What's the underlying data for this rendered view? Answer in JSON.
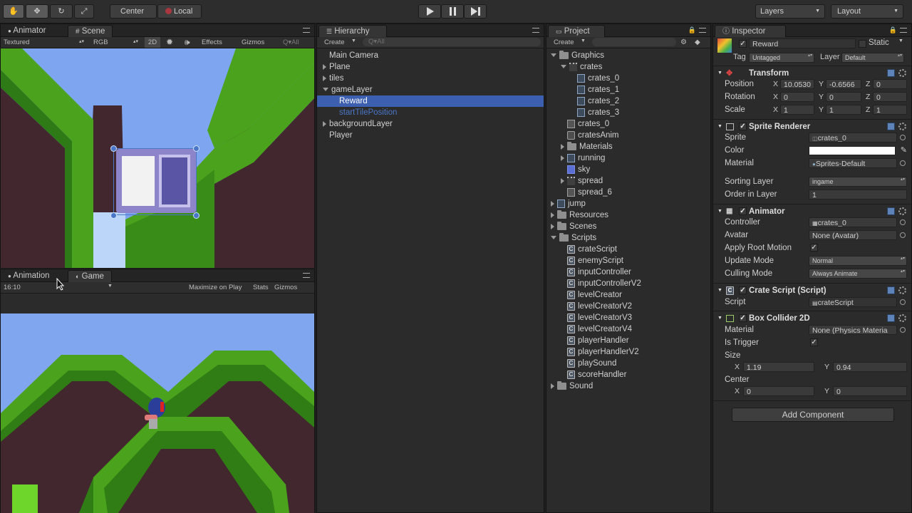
{
  "toolbar": {
    "pivot_label": "Center",
    "space_label": "Local",
    "layers_label": "Layers",
    "layout_label": "Layout"
  },
  "scene_panel": {
    "tabs": [
      "Animator",
      "Scene"
    ],
    "draw_mode": "Textured",
    "render_mode": "RGB",
    "mode_2d": "2D",
    "effects": "Effects",
    "gizmos": "Gizmos",
    "search": "Q▾All"
  },
  "game_panel": {
    "tabs": [
      "Animation",
      "Game"
    ],
    "aspect": "16:10",
    "maximize": "Maximize on Play",
    "stats": "Stats",
    "gizmos": "Gizmos"
  },
  "hierarchy": {
    "title": "Hierarchy",
    "create": "Create",
    "search": "Q▾All",
    "items": [
      {
        "label": "Main Camera",
        "indent": 0,
        "arrow": "none",
        "selected": false,
        "prefab": false
      },
      {
        "label": "Plane",
        "indent": 0,
        "arrow": "right",
        "selected": false,
        "prefab": false
      },
      {
        "label": "tiles",
        "indent": 0,
        "arrow": "right",
        "selected": false,
        "prefab": false
      },
      {
        "label": "gameLayer",
        "indent": 0,
        "arrow": "down",
        "selected": false,
        "prefab": false
      },
      {
        "label": "Reward",
        "indent": 1,
        "arrow": "none",
        "selected": true,
        "prefab": false
      },
      {
        "label": "startTilePosition",
        "indent": 1,
        "arrow": "none",
        "selected": false,
        "prefab": true
      },
      {
        "label": "backgroundLayer",
        "indent": 0,
        "arrow": "right",
        "selected": false,
        "prefab": false
      },
      {
        "label": "Player",
        "indent": 0,
        "arrow": "none",
        "selected": false,
        "prefab": false
      }
    ]
  },
  "project": {
    "title": "Project",
    "create": "Create",
    "items": [
      {
        "label": "Graphics",
        "indent": 0,
        "arrow": "down",
        "icon": "folder"
      },
      {
        "label": "crates",
        "indent": 1,
        "arrow": "down",
        "icon": "sprite-sheet"
      },
      {
        "label": "crates_0",
        "indent": 2,
        "arrow": "none",
        "icon": "sprite"
      },
      {
        "label": "crates_1",
        "indent": 2,
        "arrow": "none",
        "icon": "sprite"
      },
      {
        "label": "crates_2",
        "indent": 2,
        "arrow": "none",
        "icon": "sprite"
      },
      {
        "label": "crates_3",
        "indent": 2,
        "arrow": "none",
        "icon": "sprite"
      },
      {
        "label": "crates_0",
        "indent": 1,
        "arrow": "none",
        "icon": "animator"
      },
      {
        "label": "cratesAnim",
        "indent": 1,
        "arrow": "none",
        "icon": "anim"
      },
      {
        "label": "Materials",
        "indent": 1,
        "arrow": "right",
        "icon": "folder"
      },
      {
        "label": "running",
        "indent": 1,
        "arrow": "right",
        "icon": "sprite"
      },
      {
        "label": "sky",
        "indent": 1,
        "arrow": "none",
        "icon": "blue"
      },
      {
        "label": "spread",
        "indent": 1,
        "arrow": "right",
        "icon": "sprite-sheet"
      },
      {
        "label": "spread_6",
        "indent": 1,
        "arrow": "none",
        "icon": "animator"
      },
      {
        "label": "jump",
        "indent": 0,
        "arrow": "right",
        "icon": "sprite"
      },
      {
        "label": "Resources",
        "indent": 0,
        "arrow": "right",
        "icon": "folder"
      },
      {
        "label": "Scenes",
        "indent": 0,
        "arrow": "right",
        "icon": "folder"
      },
      {
        "label": "Scripts",
        "indent": 0,
        "arrow": "down",
        "icon": "folder"
      },
      {
        "label": "crateScript",
        "indent": 1,
        "arrow": "none",
        "icon": "script"
      },
      {
        "label": "enemyScript",
        "indent": 1,
        "arrow": "none",
        "icon": "script"
      },
      {
        "label": "inputController",
        "indent": 1,
        "arrow": "none",
        "icon": "script"
      },
      {
        "label": "inputControllerV2",
        "indent": 1,
        "arrow": "none",
        "icon": "script"
      },
      {
        "label": "levelCreator",
        "indent": 1,
        "arrow": "none",
        "icon": "script"
      },
      {
        "label": "levelCreatorV2",
        "indent": 1,
        "arrow": "none",
        "icon": "script"
      },
      {
        "label": "levelCreatorV3",
        "indent": 1,
        "arrow": "none",
        "icon": "script"
      },
      {
        "label": "levelCreatorV4",
        "indent": 1,
        "arrow": "none",
        "icon": "script"
      },
      {
        "label": "playerHandler",
        "indent": 1,
        "arrow": "none",
        "icon": "script"
      },
      {
        "label": "playerHandlerV2",
        "indent": 1,
        "arrow": "none",
        "icon": "script"
      },
      {
        "label": "playSound",
        "indent": 1,
        "arrow": "none",
        "icon": "script"
      },
      {
        "label": "scoreHandler",
        "indent": 1,
        "arrow": "none",
        "icon": "script"
      },
      {
        "label": "Sound",
        "indent": 0,
        "arrow": "right",
        "icon": "folder"
      }
    ]
  },
  "inspector": {
    "title": "Inspector",
    "object_name": "Reward",
    "static_label": "Static",
    "tag_label": "Tag",
    "tag_value": "Untagged",
    "layer_label": "Layer",
    "layer_value": "Default",
    "transform": {
      "title": "Transform",
      "position_label": "Position",
      "position": [
        "10.0530",
        "-0.6566",
        "0"
      ],
      "rotation_label": "Rotation",
      "rotation": [
        "0",
        "0",
        "0"
      ],
      "scale_label": "Scale",
      "scale": [
        "1",
        "1",
        "1"
      ]
    },
    "sprite_renderer": {
      "title": "Sprite Renderer",
      "sprite_label": "Sprite",
      "sprite": "crates_0",
      "color_label": "Color",
      "material_label": "Material",
      "material": "Sprites-Default",
      "sorting_layer_label": "Sorting Layer",
      "sorting_layer": "ingame",
      "order_label": "Order in Layer",
      "order": "1"
    },
    "animator": {
      "title": "Animator",
      "controller_label": "Controller",
      "controller": "crates_0",
      "avatar_label": "Avatar",
      "avatar": "None (Avatar)",
      "root_motion_label": "Apply Root Motion",
      "update_mode_label": "Update Mode",
      "update_mode": "Normal",
      "culling_mode_label": "Culling Mode",
      "culling_mode": "Always Animate"
    },
    "crate_script": {
      "title": "Crate Script (Script)",
      "script_label": "Script",
      "script": "crateScript"
    },
    "box_collider": {
      "title": "Box Collider 2D",
      "material_label": "Material",
      "material": "None (Physics Materia",
      "trigger_label": "Is Trigger",
      "size_label": "Size",
      "size": [
        "1.19",
        "0.94"
      ],
      "center_label": "Center",
      "center": [
        "0",
        "0"
      ]
    },
    "add_component": "Add Component"
  },
  "axes": {
    "x": "X",
    "y": "Y",
    "z": "Z"
  },
  "colors": {
    "selection": "#3d5fb0",
    "accent_blue": "#4a76c8",
    "grass": "#4aa21d",
    "sky": "#7fa6ee"
  }
}
